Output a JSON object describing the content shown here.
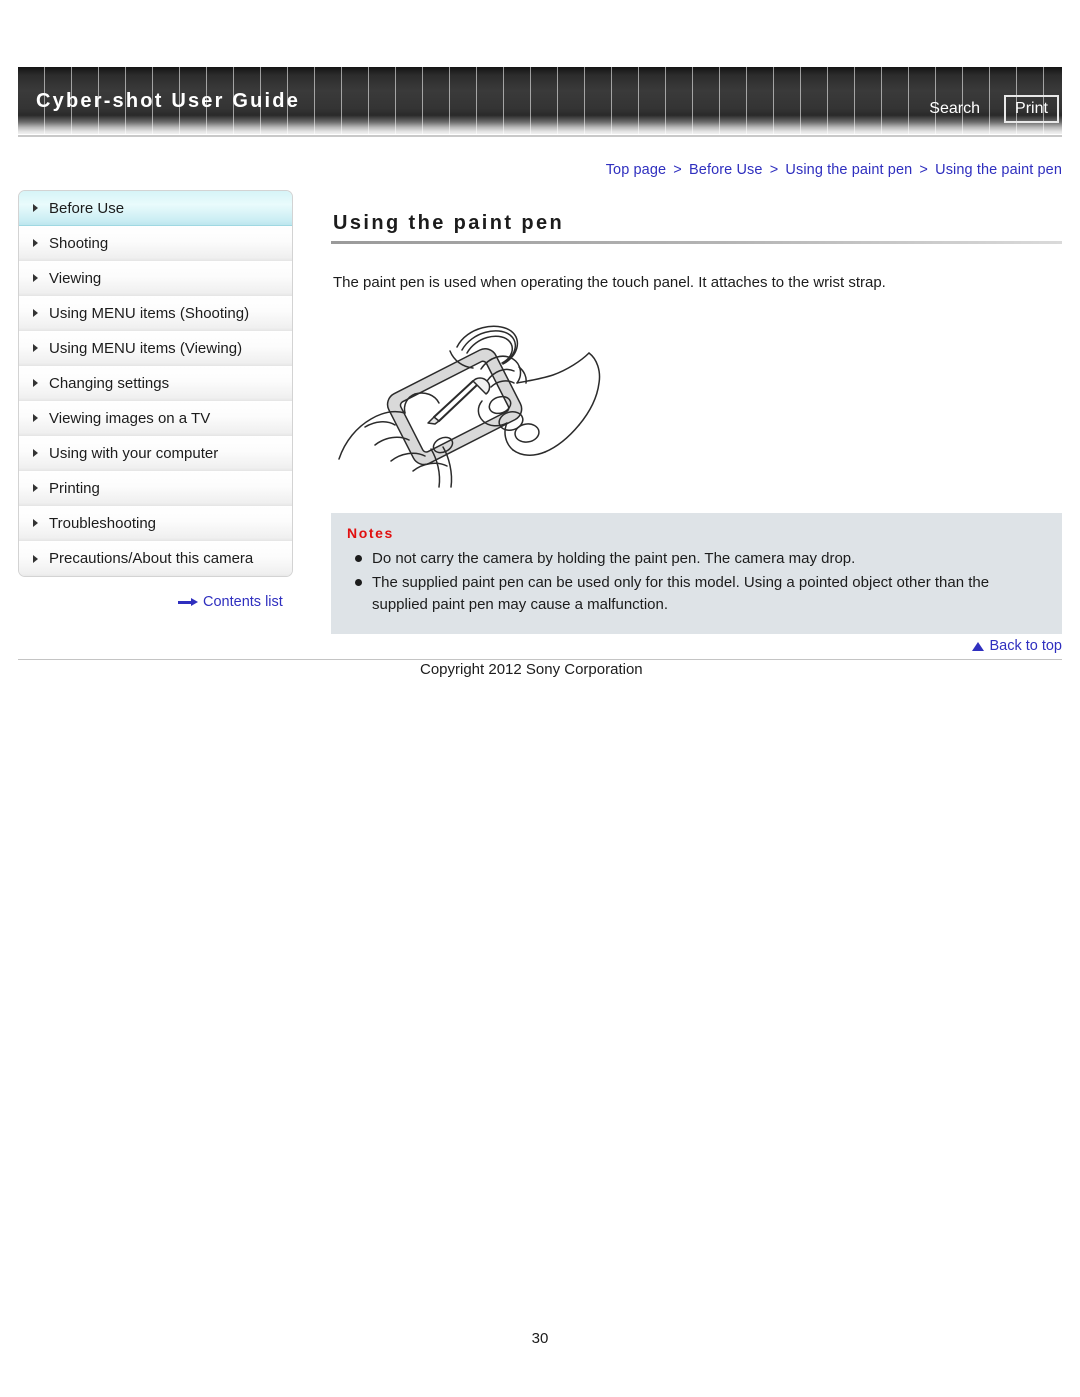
{
  "header": {
    "guide_title": "Cyber-shot User Guide",
    "search_label": "Search",
    "print_label": "Print"
  },
  "breadcrumb": {
    "separator": ">",
    "items": [
      {
        "label": "Top page"
      },
      {
        "label": "Before Use"
      },
      {
        "label": "Using the paint pen"
      },
      {
        "label": "Using the paint pen"
      }
    ]
  },
  "sidebar": {
    "items": [
      {
        "label": "Before Use",
        "active": true
      },
      {
        "label": "Shooting",
        "active": false
      },
      {
        "label": "Viewing",
        "active": false
      },
      {
        "label": "Using MENU items (Shooting)",
        "active": false
      },
      {
        "label": "Using MENU items (Viewing)",
        "active": false
      },
      {
        "label": "Changing settings",
        "active": false
      },
      {
        "label": "Viewing images on a TV",
        "active": false
      },
      {
        "label": "Using with your computer",
        "active": false
      },
      {
        "label": "Printing",
        "active": false
      },
      {
        "label": "Troubleshooting",
        "active": false
      },
      {
        "label": "Precautions/About this camera",
        "active": false
      }
    ],
    "contents_list_label": "Contents list"
  },
  "main": {
    "page_title": "Using the paint pen",
    "intro_text": "The paint pen is used when operating the touch panel. It attaches to the wrist strap.",
    "illustration_alt": "Hands holding a compact camera and touching the touch panel with the paint pen attached to the wrist strap",
    "notes": {
      "heading": "Notes",
      "items": [
        "Do not carry the camera by holding the paint pen. The camera may drop.",
        "The supplied paint pen can be used only for this model. Using a pointed object other than the supplied paint pen may cause a malfunction."
      ]
    }
  },
  "footer": {
    "back_to_top_label": "Back to top",
    "copyright": "Copyright 2012 Sony Corporation",
    "page_number": "30"
  },
  "colors": {
    "link": "#2f2fbf",
    "notes_heading": "#e11010",
    "notes_background": "#dee3e7",
    "sidebar_active": "#d6f4f7",
    "header_background": "#1a1a1a"
  }
}
